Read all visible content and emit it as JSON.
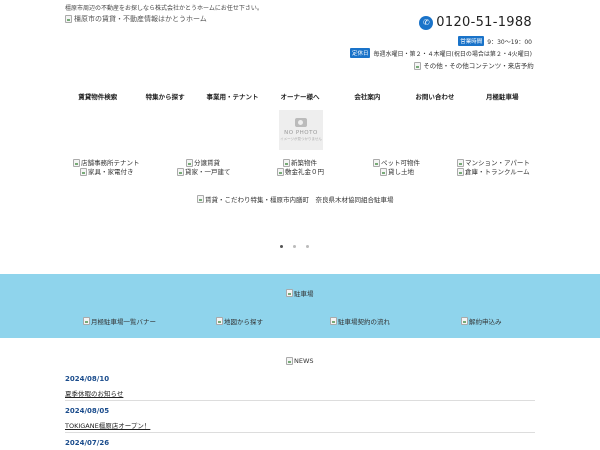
{
  "header": {
    "tagline": "橿原市周辺の不動産をお探しなら株式会社かとうホームにお任せ下さい。",
    "logo_alt": "橿原市の賃貸・不動産情報はかとうホーム",
    "phone_icon": "phone-icon",
    "phone_number": "0120-51-1988",
    "hours_badge": "営業時間",
    "hours": "9：30～19：00",
    "closed_badge": "定休日",
    "closed": "毎週水曜日・第２・４木曜日(祝日の場合は第２・4火曜日)",
    "other_link": "その他・その他コンテンツ・来店予約",
    "accent_color": "#1a73c9"
  },
  "nav": [
    "賃貸物件検索",
    "特集から探す",
    "事業用・テナント",
    "オーナー様へ",
    "会社案内",
    "お問い合わせ",
    "月極駐車場"
  ],
  "hero": {
    "nophoto_text": "NO PHOTO",
    "nophoto_sub": "イメージが見つかりません",
    "categories": [
      "店舗事務所テナント",
      "分譲賃貸",
      "新築物件",
      "ペット可物件",
      "マンション・アパート",
      "家具・家電付き",
      "貸家・一戸建て",
      "敷金礼金０円",
      "貸し土地",
      "倉庫・トランクルーム"
    ],
    "banner": "賃貸・こだわり特集・橿原市内膳町　奈良県木材協同組合駐車場",
    "slider_active_index": 0
  },
  "parking": {
    "title": "駐車場",
    "band_color": "#8fd4ec",
    "links": [
      "月極駐車場一覧バナー",
      "地図から探す",
      "駐車場契約の流れ",
      "解約申込み"
    ]
  },
  "news": {
    "title": "NEWS",
    "items": [
      {
        "date": "2024/08/10",
        "title": "夏季休暇のお知らせ"
      },
      {
        "date": "2024/08/05",
        "title": "TOKIGANE橿原店オープン！"
      },
      {
        "date": "2024/07/26",
        "title": ""
      }
    ]
  }
}
